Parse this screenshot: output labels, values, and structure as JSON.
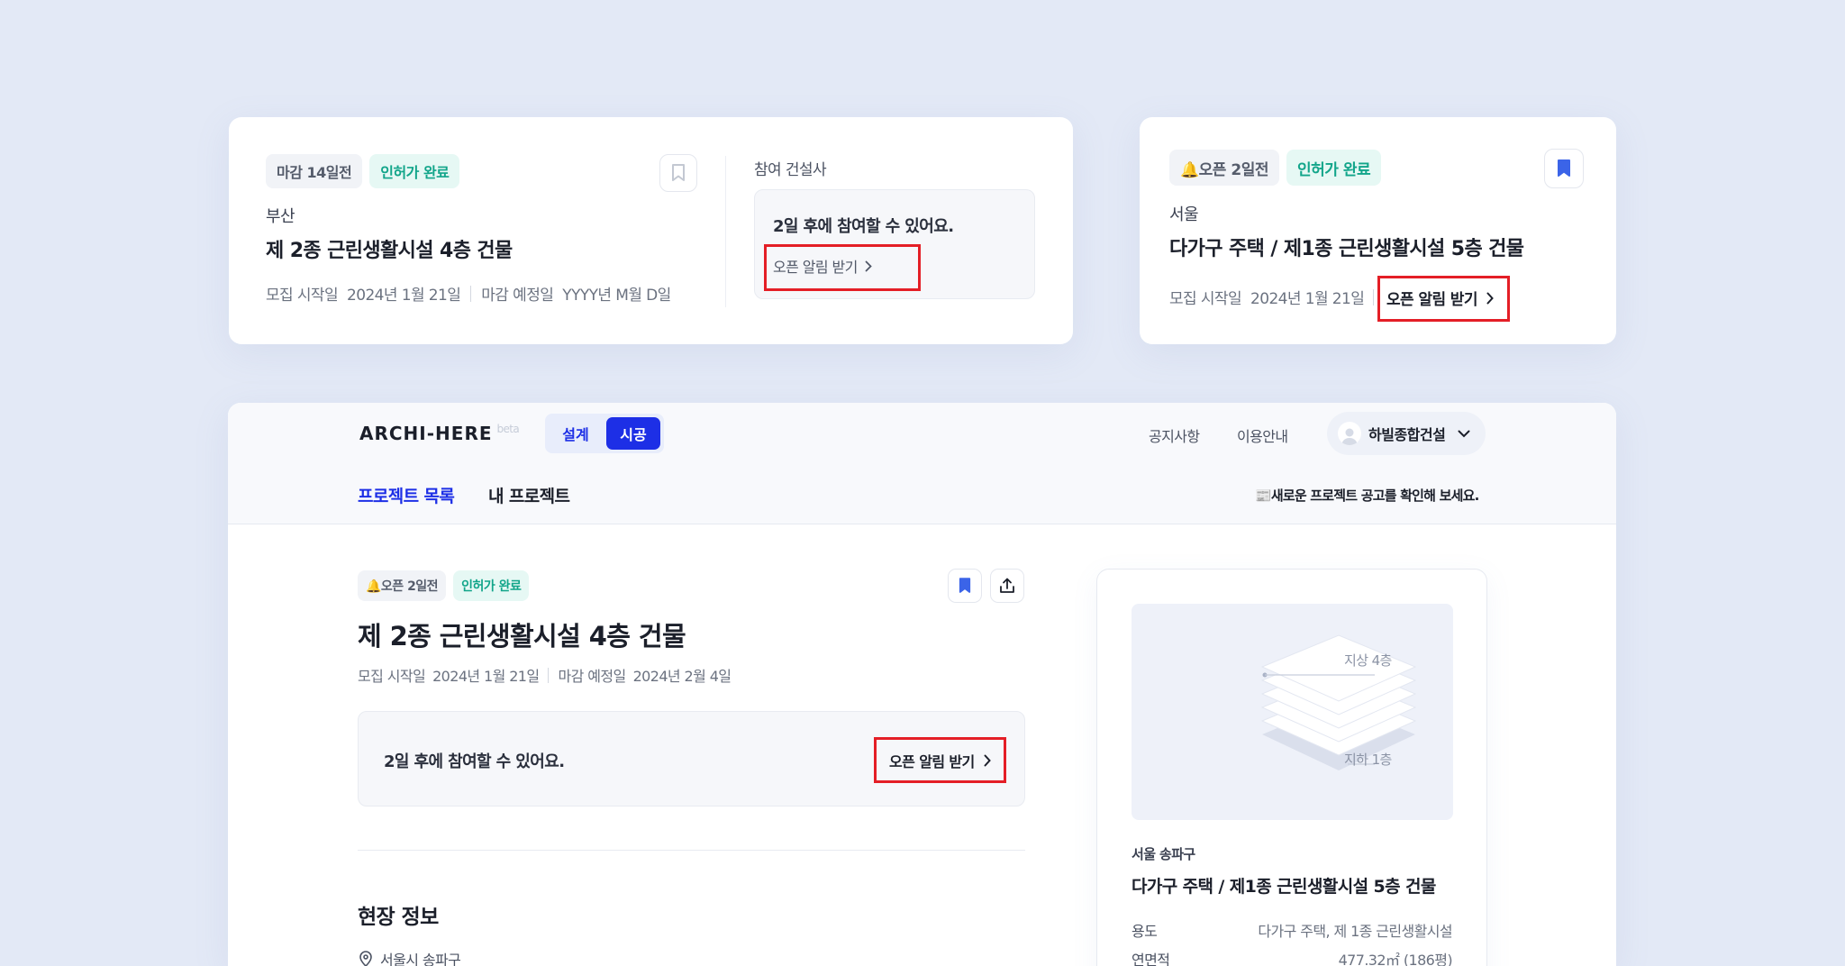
{
  "card1": {
    "chip_deadline": "마감 14일전",
    "chip_permit": "인허가 완료",
    "region": "부산",
    "title": "제 2종 근린생활시설 4층 건물",
    "start_label": "모집 시작일",
    "start_date": "2024년 1월 21일",
    "due_label": "마감 예정일",
    "due_date": "YYYY년 M월 D일",
    "builders_label": "참여 건설사",
    "join_msg": "2일 후에 참여할 수 있어요.",
    "alert_label": "오픈 알림 받기"
  },
  "card2": {
    "chip_open": "🔔오픈 2일전",
    "chip_permit": "인허가 완료",
    "region": "서울",
    "title": "다가구 주택 / 제1종 근린생활시설 5층 건물",
    "start_label": "모집 시작일",
    "start_date": "2024년 1월 21일",
    "alert_label": "오픈 알림 받기"
  },
  "app": {
    "logo": "ARCHI-HERE",
    "logo_beta": "beta",
    "toggle": [
      "설계",
      "시공"
    ],
    "nav_notice": "공지사항",
    "nav_guide": "이용안내",
    "user_name": "하빌종합건설",
    "tab_projects": "프로젝트 목록",
    "tab_my": "내 프로젝트",
    "banner": "📰새로운 프로젝트 공고를 확인해 보세요.",
    "detail": {
      "chip_open": "🔔오픈 2일전",
      "chip_permit": "인허가 완료",
      "title": "제 2종 근린생활시설 4층 건물",
      "start_label": "모집 시작일",
      "start_date": "2024년 1월 21일",
      "due_label": "마감 예정일",
      "due_date": "2024년 2월 4일",
      "join_msg": "2일 후에 참여할 수 있어요.",
      "alert_label": "오픈 알림 받기",
      "site_heading": "현장 정보",
      "location": "서울시 송파구"
    },
    "side": {
      "floor_top": "지상 4층",
      "floor_bottom": "지하 1층",
      "region": "서울 송파구",
      "title": "다가구 주택 / 제1종 근린생활시설 5층 건물",
      "use_label": "용도",
      "use_value": "다가구 주택, 제 1종 근린생활시설",
      "area_label": "연면적",
      "area_value": "477.32㎡ (186평)"
    }
  },
  "colors": {
    "brand": "#1d2fe6",
    "alert": "#e41e26",
    "teal": "#12a58a",
    "bookmark": "#3b64e8"
  }
}
